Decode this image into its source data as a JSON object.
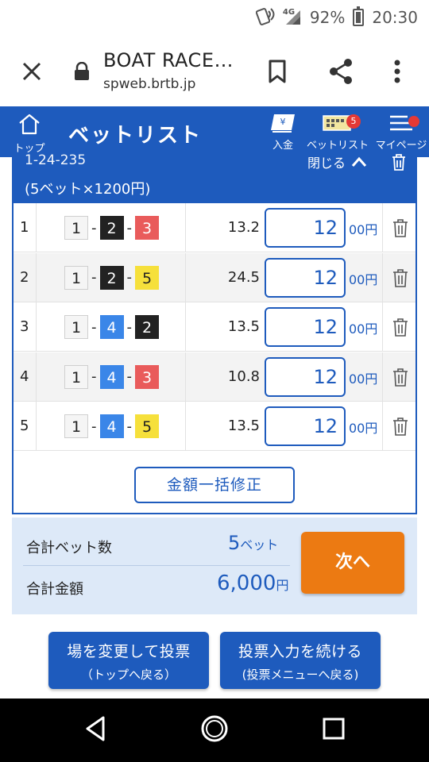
{
  "status_bar": {
    "network": "4G",
    "battery": "92%",
    "time": "20:30"
  },
  "browser": {
    "title": "BOAT RACE…",
    "url": "spweb.brtb.jp"
  },
  "header": {
    "home_label": "トップ",
    "title": "ベットリスト",
    "deposit_label": "入金",
    "betlist_label": "ベットリスト",
    "betlist_badge": "5",
    "mypage_label": "マイページ"
  },
  "panel": {
    "combo": "1-24-235",
    "summary": "(5ベット×1200円)",
    "close_label": "閉じる"
  },
  "bets": [
    {
      "no": "1",
      "boats": [
        "1",
        "2",
        "3"
      ],
      "odds": "13.2",
      "amount": "12",
      "unit": "00円"
    },
    {
      "no": "2",
      "boats": [
        "1",
        "2",
        "5"
      ],
      "odds": "24.5",
      "amount": "12",
      "unit": "00円"
    },
    {
      "no": "3",
      "boats": [
        "1",
        "4",
        "2"
      ],
      "odds": "13.5",
      "amount": "12",
      "unit": "00円"
    },
    {
      "no": "4",
      "boats": [
        "1",
        "4",
        "3"
      ],
      "odds": "10.8",
      "amount": "12",
      "unit": "00円"
    },
    {
      "no": "5",
      "boats": [
        "1",
        "4",
        "5"
      ],
      "odds": "13.5",
      "amount": "12",
      "unit": "00円"
    }
  ],
  "bulk_edit_label": "金額一括修正",
  "totals": {
    "bet_count_label": "合計ベット数",
    "bet_count_value": "5",
    "bet_count_unit": "ベット",
    "amount_label": "合計金額",
    "amount_value": "6,000",
    "amount_unit": "円"
  },
  "next_label": "次へ",
  "buttons": {
    "change_venue_l1": "場を変更して投票",
    "change_venue_l2": "（トップへ戻る）",
    "continue_l1": "投票入力を続ける",
    "continue_l2": "(投票メニューへ戻る)"
  },
  "colors": {
    "primary": "#1e5bbd",
    "next": "#ec7a12",
    "summary_bg": "#dde9f8",
    "boat2": "#222222",
    "boat3": "#e95b5b",
    "boat4": "#3a86e8",
    "boat5": "#f6e03b"
  }
}
